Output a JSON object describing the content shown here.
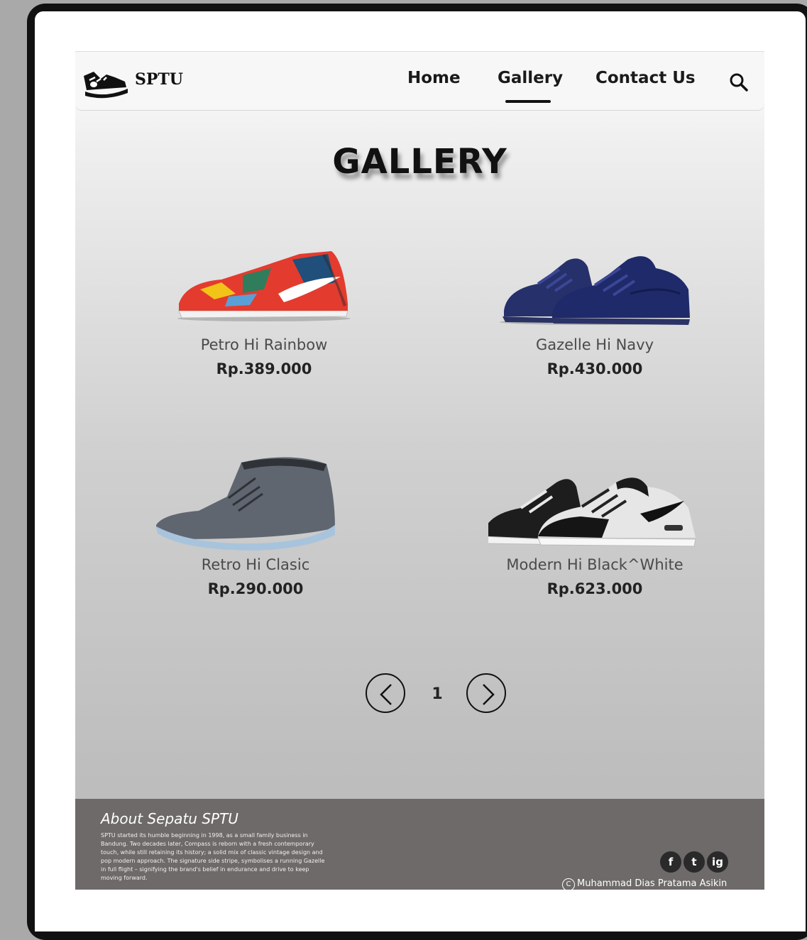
{
  "nav": {
    "brand": "SPTU",
    "links": [
      {
        "label": "Home"
      },
      {
        "label": "Gallery",
        "active": true
      },
      {
        "label": "Contact Us"
      }
    ],
    "search_icon": "search-icon"
  },
  "page_title": "GALLERY",
  "products": [
    {
      "name": "Petro Hi Rainbow",
      "price": "Rp.389.000"
    },
    {
      "name": "Gazelle Hi Navy",
      "price": "Rp.430.000"
    },
    {
      "name": "Retro Hi Clasic",
      "price": "Rp.290.000"
    },
    {
      "name": "Modern Hi Black^White",
      "price": "Rp.623.000"
    }
  ],
  "pagination": {
    "current_page": "1"
  },
  "footer": {
    "about_title": "About Sepatu SPTU",
    "about_text": "SPTU started its humble beginning in 1998, as a small family business in Bandung. Two decades later, Compass is reborn with a fresh contemporary touch, while still retaining its history; a solid mix of classic vintage design and pop modern approach. The signature side stripe, symbolises a running Gazelle in full flight – signifying the brand's belief in endurance and drive to keep moving forward.",
    "social": [
      "f",
      "t",
      "ig"
    ],
    "copyright": "Muhammad Dias Pratama Asikin"
  },
  "colors": {
    "footer_bg": "#6e6a69",
    "accent": "#111111"
  }
}
